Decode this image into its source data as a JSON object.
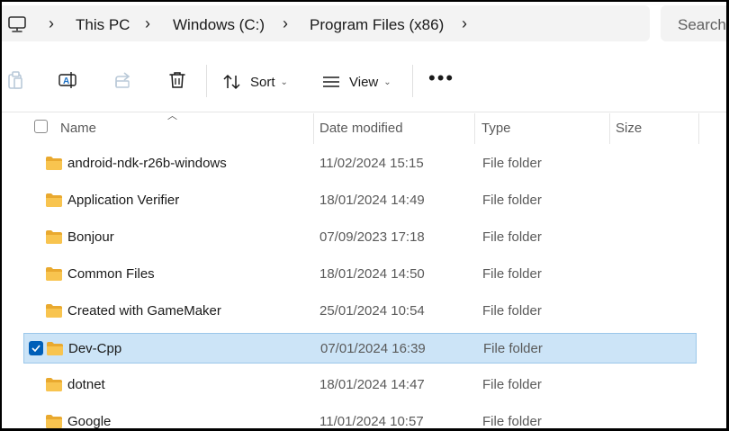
{
  "breadcrumbs": [
    "This PC",
    "Windows (C:)",
    "Program Files (x86)"
  ],
  "search": {
    "placeholder": "Search"
  },
  "toolbar": {
    "sort_label": "Sort",
    "view_label": "View",
    "more_label": "•••"
  },
  "columns": {
    "name": "Name",
    "date": "Date modified",
    "type": "Type",
    "size": "Size"
  },
  "rows": [
    {
      "name": "android-ndk-r26b-windows",
      "date": "11/02/2024 15:15",
      "type": "File folder"
    },
    {
      "name": "Application Verifier",
      "date": "18/01/2024 14:49",
      "type": "File folder"
    },
    {
      "name": "Bonjour",
      "date": "07/09/2023 17:18",
      "type": "File folder"
    },
    {
      "name": "Common Files",
      "date": "18/01/2024 14:50",
      "type": "File folder"
    },
    {
      "name": "Created with GameMaker",
      "date": "25/01/2024 10:54",
      "type": "File folder"
    },
    {
      "name": "Dev-Cpp",
      "date": "07/01/2024 16:39",
      "type": "File folder",
      "selected": true
    },
    {
      "name": "dotnet",
      "date": "18/01/2024 14:47",
      "type": "File folder"
    },
    {
      "name": "Google",
      "date": "11/01/2024 10:57",
      "type": "File folder"
    }
  ],
  "colors": {
    "selection": "#cce4f7",
    "accent": "#005fb8",
    "folder": "#f8c44f"
  }
}
